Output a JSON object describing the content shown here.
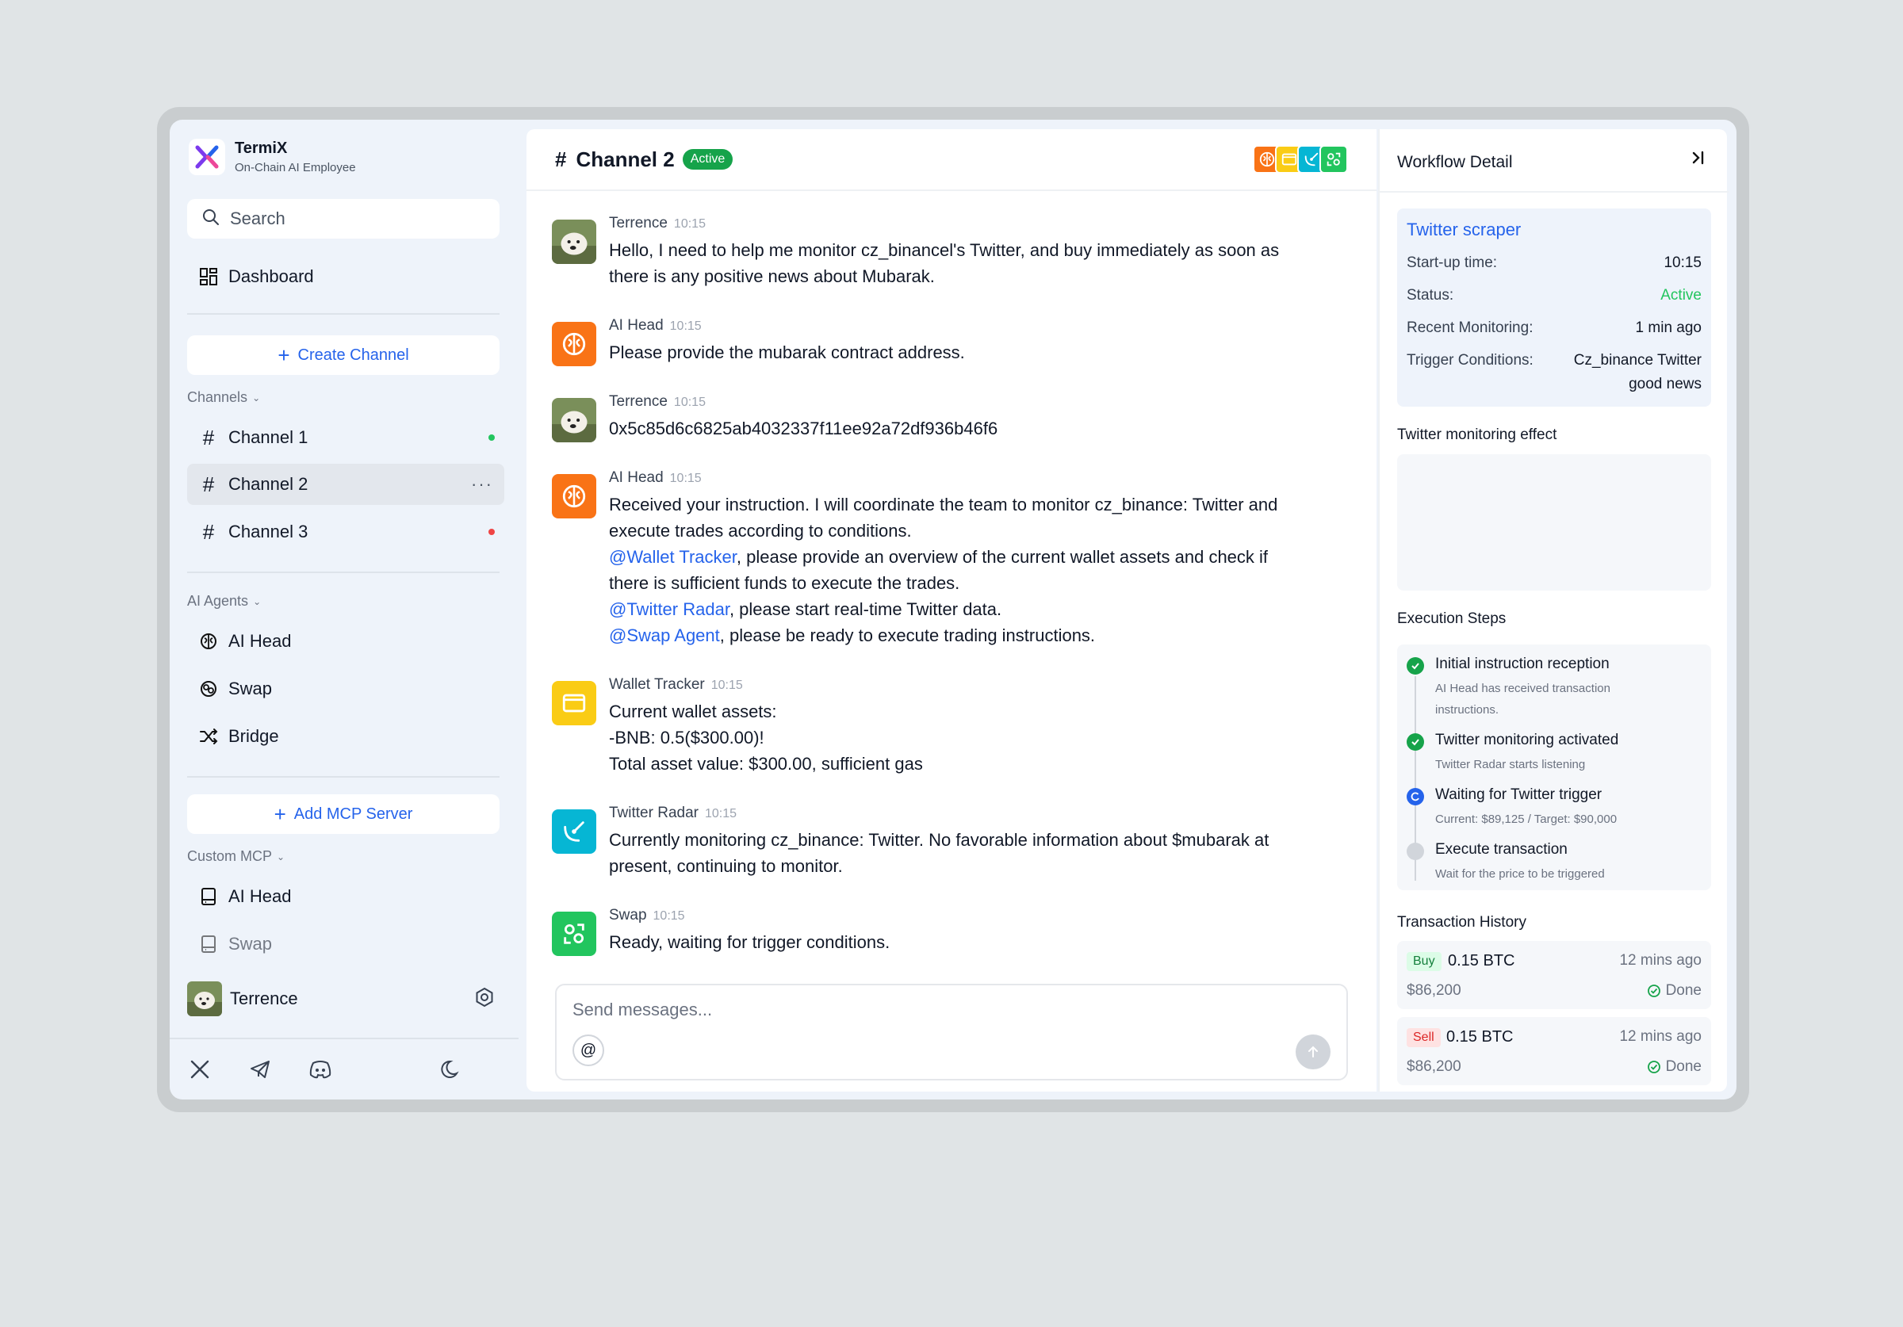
{
  "brand": {
    "name": "TermiX",
    "subtitle": "On-Chain AI Employee"
  },
  "search": {
    "placeholder": "Search"
  },
  "nav": {
    "dashboard": "Dashboard"
  },
  "create_channel": "Create Channel",
  "channels": {
    "label": "Channels",
    "items": [
      {
        "label": "Channel 1",
        "status_color": "#22c55e"
      },
      {
        "label": "Channel 2",
        "active": true
      },
      {
        "label": "Channel 3",
        "status_color": "#ef4444"
      }
    ]
  },
  "agents": {
    "label": "AI Agents",
    "items": [
      {
        "label": "AI Head",
        "icon": "brain-icon"
      },
      {
        "label": "Swap",
        "icon": "swap-icon"
      },
      {
        "label": "Bridge",
        "icon": "shuffle-icon"
      }
    ]
  },
  "add_mcp": "Add MCP Server",
  "custom_mcp": {
    "label": "Custom MCP",
    "items": [
      {
        "label": "AI Head",
        "icon": "server-icon"
      },
      {
        "label": "Swap",
        "icon": "server-icon"
      }
    ]
  },
  "user": {
    "name": "Terrence"
  },
  "chat": {
    "channel": "Channel 2",
    "status": "Active",
    "messages": [
      {
        "sender": "Terrence",
        "time": "10:15",
        "line1": "Hello, I need to help me monitor cz_binancel's Twitter, and buy immediately as soon as",
        "line2": "there is any positive news about Mubarak."
      },
      {
        "sender": "AI Head",
        "time": "10:15",
        "line1": "Please provide the mubarak contract address."
      },
      {
        "sender": "Terrence",
        "time": "10:15",
        "line1": "0x5c85d6c6825ab4032337f11ee92a72df936b46f6"
      },
      {
        "sender": "AI Head",
        "time": "10:15",
        "line1": "Received your instruction. I will coordinate the team to monitor cz_binance: Twitter and",
        "line2": "execute trades according to conditions.",
        "m1": "@Wallet Tracker",
        "t1": ", please provide an overview of the current wallet assets and check if",
        "t1b": "there is sufficient funds to execute the trades.",
        "m2": "@Twitter Radar",
        "t2": ", please start real-time Twitter data.",
        "m3": "@Swap Agent",
        "t3": ", please be ready to execute trading instructions."
      },
      {
        "sender": "Wallet Tracker",
        "time": "10:15",
        "line1": "Current wallet assets:",
        "line2": "-BNB: 0.5($300.00)!",
        "line3": "Total asset value: $300.00, sufficient gas"
      },
      {
        "sender": "Twitter Radar",
        "time": "10:15",
        "line1": "Currently monitoring cz_binance: Twitter. No favorable information about $mubarak at",
        "line2": "present, continuing to monitor."
      },
      {
        "sender": "Swap",
        "time": "10:15",
        "line1": "Ready, waiting for trigger conditions."
      }
    ],
    "composer_placeholder": "Send messages..."
  },
  "panel": {
    "title": "Workflow Detail",
    "card": {
      "title": "Twitter scraper",
      "startup_label": "Start-up time:",
      "startup": "10:15",
      "status_label": "Status:",
      "status": "Active",
      "recent_label": "Recent Monitoring:",
      "recent": "1 min ago",
      "trigger_label": "Trigger Conditions:",
      "trigger1": "Cz_binance Twitter",
      "trigger2": "good news"
    },
    "effect_title": "Twitter monitoring effect",
    "steps_title": "Execution Steps",
    "steps": [
      {
        "title": "Initial instruction reception",
        "d1": "AI Head has received transaction",
        "d2": "instructions.",
        "state": "done"
      },
      {
        "title": "Twitter monitoring activated",
        "d1": "Twitter Radar starts listening",
        "state": "done"
      },
      {
        "title": "Waiting for Twitter trigger",
        "d1": "Current: $89,125 / Target: $90,000",
        "state": "in-progress"
      },
      {
        "title": "Execute transaction",
        "d1": "Wait for the price to be triggered",
        "state": "pending"
      }
    ],
    "history_title": "Transaction History",
    "history": [
      {
        "side": "Buy",
        "amount": "0.15 BTC",
        "ago": "12 mins ago",
        "price": "$86,200",
        "status": "Done"
      },
      {
        "side": "Sell",
        "amount": "0.15 BTC",
        "ago": "12 mins ago",
        "price": "$86,200",
        "status": "Done"
      }
    ]
  },
  "colors": {
    "accent": "#2563eb",
    "success": "#16a34a",
    "ai_head": "#f97316",
    "wallet": "#facc15",
    "radar": "#06b6d4",
    "swap": "#22c55e"
  }
}
